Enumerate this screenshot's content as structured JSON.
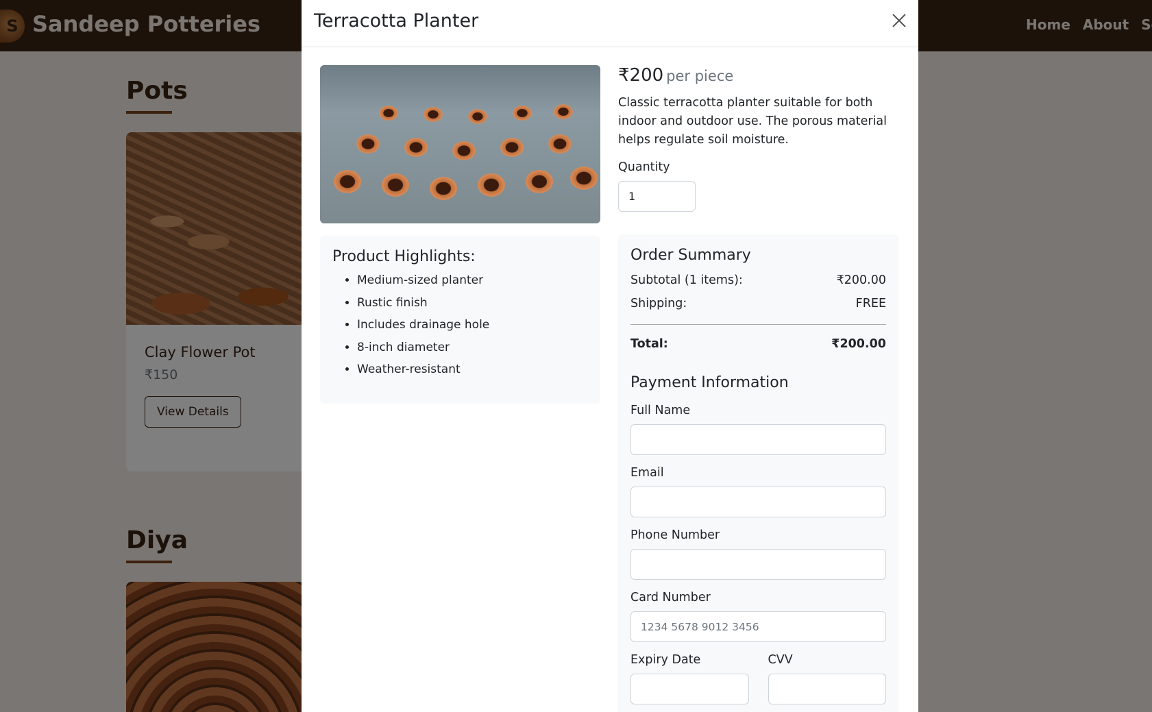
{
  "navbar": {
    "logo_letter": "S",
    "brand": "Sandeep Potteries",
    "links": [
      "Home",
      "About",
      "Serv"
    ]
  },
  "sections": {
    "pots": {
      "title": "Pots",
      "card": {
        "title": "Clay Flower Pot",
        "price": "₹150",
        "button": "View Details"
      }
    },
    "diya": {
      "title": "Diya"
    }
  },
  "modal": {
    "title": "Terracotta Planter",
    "price": "₹200",
    "price_unit": "per piece",
    "description": "Classic terracotta planter suitable for both indoor and outdoor use. The porous material helps regulate soil moisture.",
    "quantity_label": "Quantity",
    "quantity_value": "1",
    "highlights_title": "Product Highlights:",
    "highlights": [
      "Medium-sized planter",
      "Rustic finish",
      "Includes drainage hole",
      "8-inch diameter",
      "Weather-resistant"
    ],
    "summary": {
      "title": "Order Summary",
      "subtotal_label": "Subtotal (1 items):",
      "subtotal_value": "₹200.00",
      "shipping_label": "Shipping:",
      "shipping_value": "FREE",
      "total_label": "Total:",
      "total_value": "₹200.00"
    },
    "payment": {
      "title": "Payment Information",
      "full_name_label": "Full Name",
      "email_label": "Email",
      "phone_label": "Phone Number",
      "card_label": "Card Number",
      "card_placeholder": "1234 5678 9012 3456",
      "expiry_label": "Expiry Date",
      "cvv_label": "CVV"
    }
  }
}
